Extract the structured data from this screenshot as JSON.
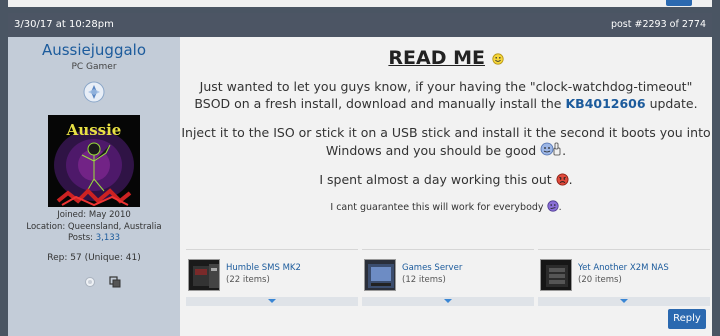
{
  "post": {
    "date": "3/30/17 at 10:28pm",
    "post_number": "post #2293 of 2774"
  },
  "user": {
    "name": "Aussiejuggalo",
    "title": "PC Gamer",
    "avatar_text": "Aussie",
    "joined": "Joined: May 2010",
    "location": "Location: Queensland, Australia",
    "posts_label": "Posts: ",
    "posts_value": "3,133",
    "rep": "Rep: 57 (Unique: 41)"
  },
  "message": {
    "title": "READ ME",
    "p1_a": "Just wanted to let you guys know, if your having the \"clock-watchdog-timeout\" BSOD on a fresh install, download and manually install the ",
    "p1_link": "KB4012606",
    "p1_b": " update.",
    "p2": "Inject it to the ISO or stick it on a USB stick and install it the second it boots you into Windows and you should be good ",
    "p3": "I spent almost a day working this out ",
    "p4": "I cant guarantee this will work for everybody "
  },
  "rigs": [
    {
      "name": "Humble SMS MK2",
      "count": "(22 items)"
    },
    {
      "name": "Games Server",
      "count": "(12 items)"
    },
    {
      "name": "Yet Another X2M NAS",
      "count": "(20 items)"
    }
  ],
  "actions": {
    "reply_label": "Reply"
  },
  "colors": {
    "header_bg": "#4c5564",
    "userpane_bg": "#c3ccd8",
    "link": "#1c5b9c",
    "reply_button": "#2b69b0"
  }
}
